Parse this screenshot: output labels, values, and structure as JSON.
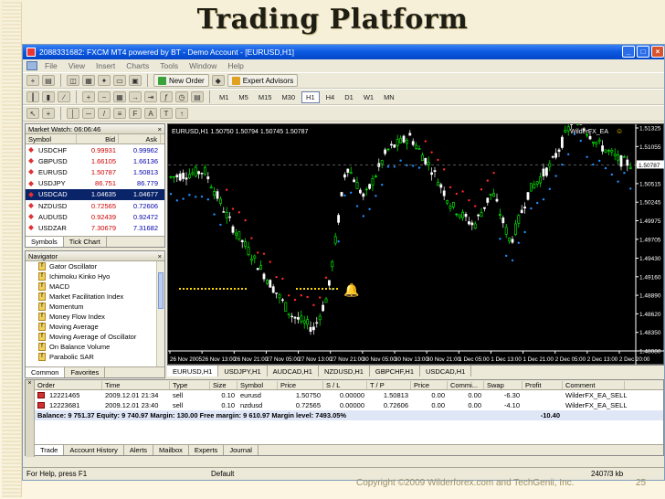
{
  "slide": {
    "title": "Trading Platform",
    "copyright": "Copyright ©2009 Wilderforex.com and TechGenii, Inc.",
    "page_number": "25"
  },
  "window": {
    "title": "2088331682: FXCM MT4 powered by BT - Demo Account - [EURUSD,H1]"
  },
  "menu": [
    "File",
    "View",
    "Insert",
    "Charts",
    "Tools",
    "Window",
    "Help"
  ],
  "toolbar": {
    "new_order": "New Order",
    "expert_advisors": "Expert Advisors",
    "timeframes": [
      "M1",
      "M5",
      "M15",
      "M30",
      "H1",
      "H4",
      "D1",
      "W1",
      "MN"
    ],
    "active_timeframe": "H1"
  },
  "market_watch": {
    "title": "Market Watch: 06:06:46",
    "columns": [
      "Symbol",
      "Bid",
      "Ask"
    ],
    "rows": [
      {
        "symbol": "USDCHF",
        "bid": "0.99931",
        "ask": "0.99962"
      },
      {
        "symbol": "GBPUSD",
        "bid": "1.66105",
        "ask": "1.66136"
      },
      {
        "symbol": "EURUSD",
        "bid": "1.50787",
        "ask": "1.50813"
      },
      {
        "symbol": "USDJPY",
        "bid": "86.751",
        "ask": "86.779"
      },
      {
        "symbol": "USDCAD",
        "bid": "1.04635",
        "ask": "1.04677"
      },
      {
        "symbol": "NZDUSD",
        "bid": "0.72565",
        "ask": "0.72606"
      },
      {
        "symbol": "AUDUSD",
        "bid": "0.92439",
        "ask": "0.92472"
      },
      {
        "symbol": "USDZAR",
        "bid": "7.30679",
        "ask": "7.31682"
      }
    ],
    "selected_symbol": "USDCAD",
    "tabs": [
      "Symbols",
      "Tick Chart"
    ]
  },
  "navigator": {
    "title": "Navigator",
    "items": [
      "Gator Oscillator",
      "Ichimoku Kinko Hyo",
      "MACD",
      "Market Facilitation Index",
      "Momentum",
      "Money Flow Index",
      "Moving Average",
      "Moving Average of Oscillator",
      "On Balance Volume",
      "Parabolic SAR"
    ],
    "tabs": [
      "Common",
      "Favorites"
    ]
  },
  "chart": {
    "header": "EURUSD,H1  1.50750 1.50794 1.50745 1.50787",
    "ea_label": "WilderFX_EA",
    "current_price": "1.50787",
    "tabs": [
      "EURUSD,H1",
      "USDJPY,H1",
      "AUDCAD,H1",
      "NZDUSD,H1",
      "GBPCHF,H1",
      "USDCAD,H1"
    ],
    "active_tab": "EURUSD,H1"
  },
  "chart_data": {
    "type": "candlestick",
    "symbol": "EURUSD",
    "timeframe": "H1",
    "ohlc": {
      "open": 1.5075,
      "high": 1.50794,
      "low": 1.50745,
      "close": 1.50787
    },
    "y_ticks": [
      1.51325,
      1.51055,
      1.50787,
      1.50515,
      1.50245,
      1.49975,
      1.49705,
      1.4943,
      1.4916,
      1.4889,
      1.4862,
      1.4835,
      1.4808
    ],
    "ylim": [
      1.4808,
      1.51325
    ],
    "x_ticks": [
      "26 Nov 2005",
      "26 Nov 13:00",
      "26 Nov 21:00",
      "27 Nov 05:00",
      "27 Nov 13:00",
      "27 Nov 21:00",
      "30 Nov 05:00",
      "30 Nov 13:00",
      "30 Nov 21:00",
      "1 Dec 05:00",
      "1 Dec 13:00",
      "1 Dec 21:00",
      "2 Dec 05:00",
      "2 Dec 13:00",
      "2 Dec 20:00"
    ],
    "indicator": "Parabolic SAR",
    "colors": {
      "bull": "#00ff00",
      "bear": "#ffffff",
      "sar_up": "#1e90ff",
      "sar_down": "#ff2a2a",
      "stop_line": "#ffd700"
    }
  },
  "terminal": {
    "columns": [
      "Order",
      "Time",
      "Type",
      "Size",
      "Symbol",
      "Price",
      "S / L",
      "T / P",
      "Price",
      "Commi...",
      "Swap",
      "Profit",
      "Comment"
    ],
    "orders": [
      {
        "order": "12221465",
        "time": "2009.12.01 21:34",
        "type": "sell",
        "size": "0.10",
        "symbol": "eurusd",
        "price": "1.50750",
        "sl": "0.00000",
        "tp": "1.50813",
        "cur_price": "0.00",
        "commission": "0.00",
        "swap": "-6.30",
        "comment": "WilderFX_EA_SELL"
      },
      {
        "order": "12223681",
        "time": "2009.12.01 23:40",
        "type": "sell",
        "size": "0.10",
        "symbol": "nzdusd",
        "price": "0.72565",
        "sl": "0.00000",
        "tp": "0.72606",
        "cur_price": "0.00",
        "commission": "0.00",
        "swap": "-4.10",
        "comment": "WilderFX_EA_SELL"
      }
    ],
    "balance_line": "Balance: 9 751.37  Equity: 9 740.97  Margin: 130.00  Free margin: 9 610.97  Margin level: 7493.05%",
    "total_profit": "-10.40",
    "tabs": [
      "Trade",
      "Account History",
      "Alerts",
      "Mailbox",
      "Experts",
      "Journal"
    ]
  },
  "status": {
    "help": "For Help, press F1",
    "profile": "Default",
    "traffic": "2407/3 kb"
  }
}
